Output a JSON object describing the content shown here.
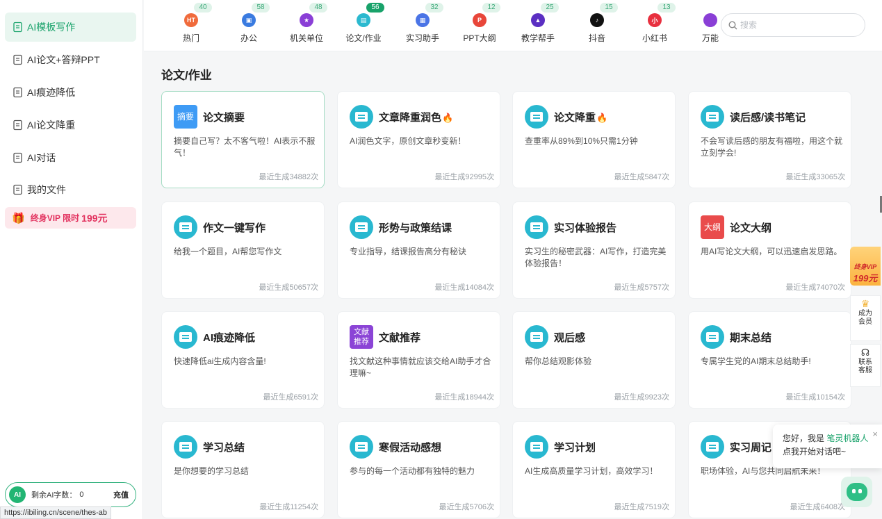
{
  "sidebar": {
    "items": [
      {
        "label": "AI模板写作",
        "icon": "template-icon",
        "active": true
      },
      {
        "label": "AI论文+答辩PPT",
        "icon": "document-icon"
      },
      {
        "label": "AI痕迹降低",
        "icon": "ai-trace-icon"
      },
      {
        "label": "AI论文降重",
        "icon": "ai-dedup-icon"
      },
      {
        "label": "AI对话",
        "icon": "chat-icon"
      },
      {
        "label": "我的文件",
        "icon": "file-icon"
      }
    ],
    "vip": {
      "text": "终身VIP 限时",
      "price": "199元"
    },
    "credits": {
      "avatar": "AI",
      "label": "剩余AI字数：",
      "value": "0",
      "action": "充值"
    }
  },
  "status_url": "https://ibiling.cn/scene/thes-ab",
  "topbar": {
    "categories": [
      {
        "label": "热门",
        "count": "40",
        "color": "#f06b3c",
        "icon_text": "HT"
      },
      {
        "label": "办公",
        "count": "58",
        "color": "#3a7be0",
        "icon_text": "▣"
      },
      {
        "label": "机关单位",
        "count": "48",
        "color": "#8a3fd6",
        "icon_text": "★"
      },
      {
        "label": "论文/作业",
        "count": "56",
        "color": "#2bb9cf",
        "icon_text": "▤",
        "active": true
      },
      {
        "label": "实习助手",
        "count": "32",
        "color": "#4a74e6",
        "icon_text": "▦"
      },
      {
        "label": "PPT大纲",
        "count": "12",
        "color": "#e8463a",
        "icon_text": "P"
      },
      {
        "label": "教学帮手",
        "count": "25",
        "color": "#5b2fc2",
        "icon_text": "▲"
      },
      {
        "label": "抖音",
        "count": "15",
        "color": "#111111",
        "icon_text": "♪"
      },
      {
        "label": "小红书",
        "count": "13",
        "color": "#e8303f",
        "icon_text": "小"
      },
      {
        "label": "万能",
        "count": "",
        "color": "#8a3fd6",
        "icon_text": ""
      }
    ],
    "search_placeholder": "搜索"
  },
  "section": {
    "title": "论文/作业"
  },
  "cards": [
    {
      "title": "论文摘要",
      "desc": "摘要自己写？太不客气啦！AI表示不服气！",
      "stat": "最近生成34882次",
      "icon": "tag",
      "tag": "摘要",
      "tag_color": "#3e9bf5",
      "selected": true
    },
    {
      "title": "文章降重润色",
      "desc": "AI润色文字，原创文章秒变新！",
      "stat": "最近生成92995次",
      "icon": "book",
      "hot": true
    },
    {
      "title": "论文降重",
      "desc": "查重率从89%到10%只需1分钟",
      "stat": "最近生成5847次",
      "icon": "book",
      "hot": true
    },
    {
      "title": "读后感/读书笔记",
      "desc": "不会写读后感的朋友有福啦，用这个就立刻学会!",
      "stat": "最近生成33065次",
      "icon": "book"
    },
    {
      "title": "作文一键写作",
      "desc": "给我一个题目，AI帮您写作文",
      "stat": "最近生成50657次",
      "icon": "book"
    },
    {
      "title": "形势与政策结课",
      "desc": "专业指导，结课报告高分有秘诀",
      "stat": "最近生成14084次",
      "icon": "book"
    },
    {
      "title": "实习体验报告",
      "desc": "实习生的秘密武器：AI写作，打造完美体验报告！",
      "stat": "最近生成5757次",
      "icon": "book"
    },
    {
      "title": "论文大纲",
      "desc": "用AI写论文大纲，可以迅速启发思路。",
      "stat": "最近生成74070次",
      "icon": "tag",
      "tag": "大纲",
      "tag_color": "#e94b4b"
    },
    {
      "title": "AI痕迹降低",
      "desc": "快速降低ai生成内容含量!",
      "stat": "最近生成6591次",
      "icon": "book"
    },
    {
      "title": "文献推荐",
      "desc": "找文献这种事情就应该交给AI助手才合理嘛~",
      "stat": "最近生成18944次",
      "icon": "tag",
      "tag": "文献推荐",
      "tag_color": "#8b44d6"
    },
    {
      "title": "观后感",
      "desc": "帮你总结观影体验",
      "stat": "最近生成9923次",
      "icon": "book"
    },
    {
      "title": "期末总结",
      "desc": "专属学生党的AI期末总结助手!",
      "stat": "最近生成10154次",
      "icon": "book"
    },
    {
      "title": "学习总结",
      "desc": "是你想要的学习总结",
      "stat": "最近生成11254次",
      "icon": "book"
    },
    {
      "title": "寒假活动感想",
      "desc": "参与的每一个活动都有独特的魅力",
      "stat": "最近生成5706次",
      "icon": "book"
    },
    {
      "title": "学习计划",
      "desc": "AI生成高质量学习计划，高效学习！",
      "stat": "最近生成7519次",
      "icon": "book"
    },
    {
      "title": "实习周记",
      "desc": "职场体验，AI与您共同启航未来！",
      "stat": "最近生成6408次",
      "icon": "book"
    }
  ],
  "float": {
    "vip_top": "终身VIP",
    "vip_price": "199元",
    "member": "成为会员",
    "service": "联系客服"
  },
  "chat": {
    "greeting": "您好，我是",
    "bot_name": "笔灵机器人",
    "line2": "点我开始对话吧~"
  }
}
